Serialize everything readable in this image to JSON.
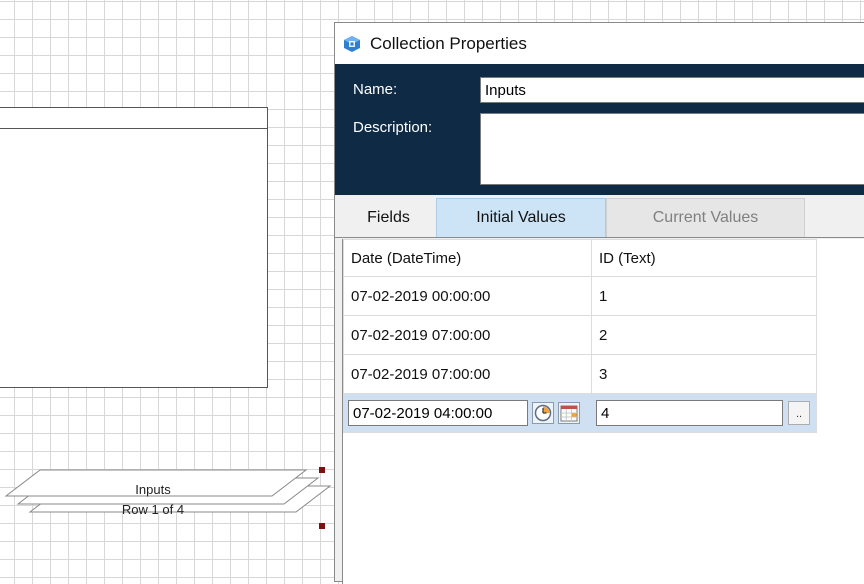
{
  "dialog": {
    "title": "Collection Properties",
    "icon": "collection-app-icon",
    "name_label": "Name:",
    "name_value": "Inputs",
    "description_label": "Description:",
    "description_value": ""
  },
  "tabs": [
    {
      "label": "Fields",
      "state": "normal"
    },
    {
      "label": "Initial Values",
      "state": "active"
    },
    {
      "label": "Current Values",
      "state": "disabled"
    }
  ],
  "grid": {
    "columns": [
      "Date  (DateTime)",
      "ID  (Text)"
    ],
    "rows": [
      {
        "date": "07-02-2019 00:00:00",
        "id": "1"
      },
      {
        "date": "07-02-2019 07:00:00",
        "id": "2"
      },
      {
        "date": "07-02-2019 07:00:00",
        "id": "3"
      }
    ],
    "edit_row": {
      "date": "07-02-2019 04:00:00",
      "id": "4",
      "ellipsis": ".."
    }
  },
  "canvas": {
    "collection_title": "Inputs",
    "collection_subtitle": "Row 1 of 4"
  },
  "colors": {
    "header_panel": "#0f2a45",
    "active_tab": "#cde4f7",
    "edit_row": "#cfe0f2",
    "selection_handle": "#7a1010"
  }
}
